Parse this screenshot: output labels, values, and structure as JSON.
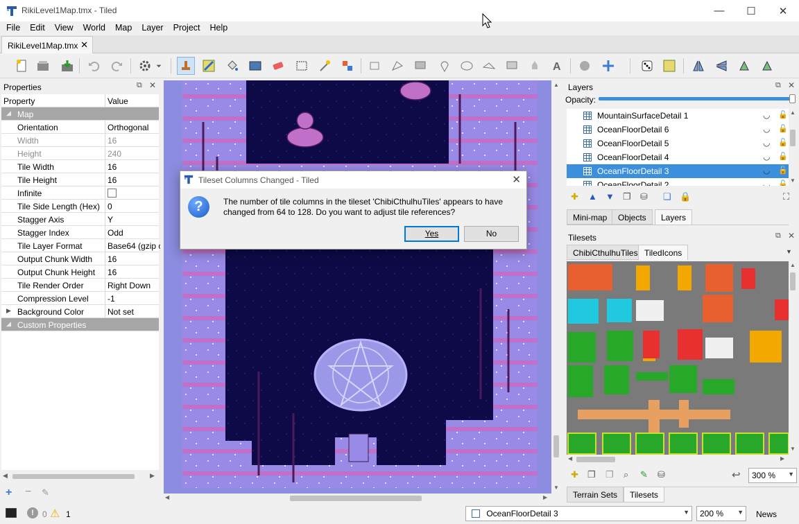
{
  "window": {
    "title": "RikiLevel1Map.tmx - Tiled",
    "minimize": "—",
    "maximize": "☐",
    "close": "✕"
  },
  "menu": [
    "File",
    "Edit",
    "View",
    "World",
    "Map",
    "Layer",
    "Project",
    "Help"
  ],
  "document_tab": {
    "label": "RikiLevel1Map.tmx",
    "close": "✕"
  },
  "properties_panel": {
    "title": "Properties",
    "col_property": "Property",
    "col_value": "Value",
    "rows": [
      {
        "k": "Map",
        "v": "",
        "type": "group"
      },
      {
        "k": "Orientation",
        "v": "Orthogonal"
      },
      {
        "k": "Width",
        "v": "16",
        "type": "disabled"
      },
      {
        "k": "Height",
        "v": "240",
        "type": "disabled"
      },
      {
        "k": "Tile Width",
        "v": "16"
      },
      {
        "k": "Tile Height",
        "v": "16"
      },
      {
        "k": "Infinite",
        "v": "",
        "type": "checkbox"
      },
      {
        "k": "Tile Side Length (Hex)",
        "v": "0"
      },
      {
        "k": "Stagger Axis",
        "v": "Y"
      },
      {
        "k": "Stagger Index",
        "v": "Odd"
      },
      {
        "k": "Tile Layer Format",
        "v": "Base64 (gzip c"
      },
      {
        "k": "Output Chunk Width",
        "v": "16"
      },
      {
        "k": "Output Chunk Height",
        "v": "16"
      },
      {
        "k": "Tile Render Order",
        "v": "Right Down"
      },
      {
        "k": "Compression Level",
        "v": "-1"
      },
      {
        "k": "Background Color",
        "v": "Not set",
        "type": "expandable"
      },
      {
        "k": "Custom Properties",
        "v": "",
        "type": "group"
      }
    ]
  },
  "dialog": {
    "title": "Tileset Columns Changed - Tiled",
    "message": "The number of tile columns in the tileset 'ChibiCthulhuTiles' appears to have changed from 64 to 128. Do you want to adjust tile references?",
    "yes": "Yes",
    "no": "No",
    "icon_glyph": "?"
  },
  "layers_panel": {
    "title": "Layers",
    "opacity_label": "Opacity:",
    "opacity": 1.0,
    "items": [
      {
        "name": "MountainSurfaceDetail 1"
      },
      {
        "name": "OceanFloorDetail 6"
      },
      {
        "name": "OceanFloorDetail 5"
      },
      {
        "name": "OceanFloorDetail 4"
      },
      {
        "name": "OceanFloorDetail 3",
        "selected": true
      },
      {
        "name": "OceanFloorDetail 2"
      }
    ],
    "tabs": [
      "Mini-map",
      "Objects",
      "Layers"
    ],
    "active_tab": "Layers"
  },
  "tilesets_panel": {
    "title": "Tilesets",
    "tabs": [
      "ChibiCthulhuTiles",
      "TiledIcons"
    ],
    "active_tab": "TiledIcons",
    "zoom": "300 %",
    "bottom_tabs": [
      "Terrain Sets",
      "Tilesets"
    ],
    "active_bottom_tab": "Tilesets"
  },
  "statusbar": {
    "errors": "0",
    "warnings": "1",
    "layer_combo": "OceanFloorDetail 3",
    "zoom_combo": "200 %",
    "news": "News"
  }
}
